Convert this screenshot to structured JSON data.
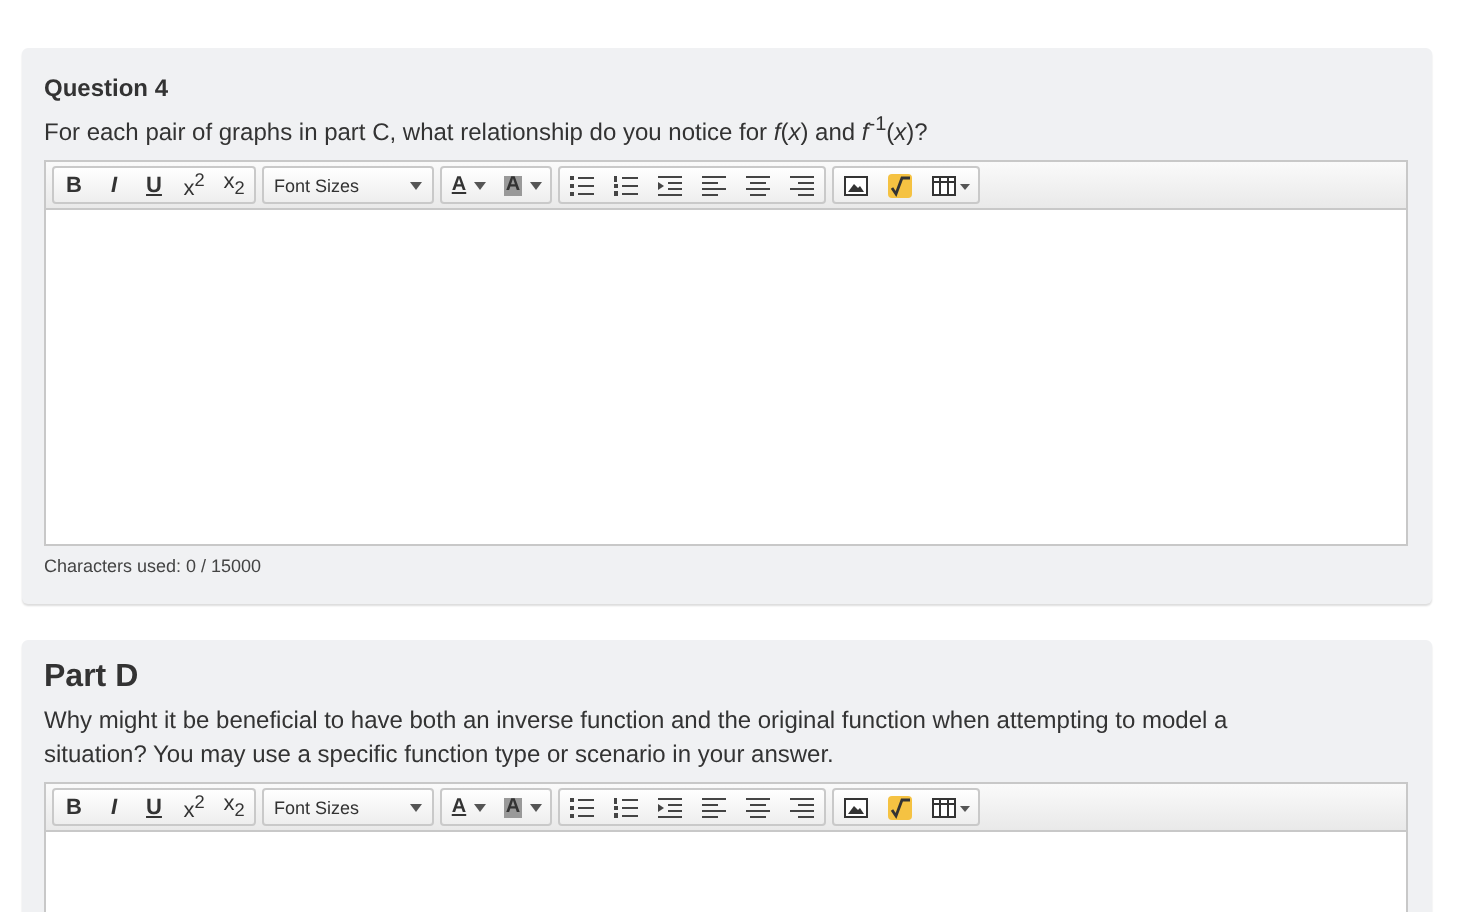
{
  "sections": [
    {
      "title": "Question 4",
      "prompt": "For each pair of graphs in part C, what relationship do you notice for *f*(*x*) and *f*$^{-1}$(*x*)?",
      "kind": "question",
      "editor": {
        "format_buttons": [
          "B",
          "I",
          "U",
          "x$^{2}$",
          "x$_{2}$"
        ],
        "font_sizes": "Font Sizes",
        "color_buttons": [
          "A",
          "A"
        ],
        "counter": "Characters used: 0 / 15000"
      }
    },
    {
      "title": "Part D",
      "prompt": "Why might it be beneficial to have both an inverse function and the original function when attempting to model a situation? You may use a specific function type or scenario in your answer.",
      "kind": "part",
      "editor": {
        "format_buttons": [
          "B",
          "I",
          "U",
          "x$^{2}$",
          "x$_{2}$"
        ],
        "font_sizes": "Font Sizes",
        "color_buttons": [
          "A",
          "A"
        ]
      }
    }
  ]
}
